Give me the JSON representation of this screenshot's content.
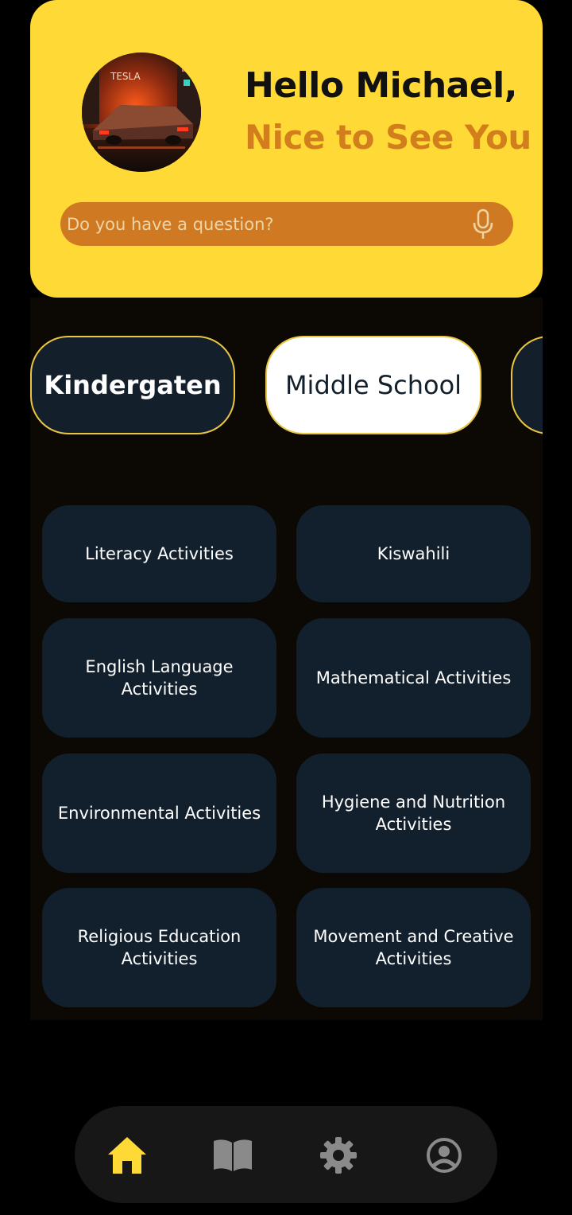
{
  "header": {
    "greeting": "Hello Michael,",
    "subgreeting": "Nice to See You",
    "search_placeholder": "Do you have a question?"
  },
  "levels": [
    {
      "label": "Kindergaten",
      "selected": false
    },
    {
      "label": "Middle School",
      "selected": true
    },
    {
      "label": "",
      "selected": false
    }
  ],
  "activities": [
    "Literacy Activities",
    "Kiswahili",
    "English Language Activities",
    "Mathematical Activities",
    "Environmental Activities",
    "Hygiene and Nutrition Activities",
    "Religious Education Activities",
    "Movement and Creative Activities"
  ],
  "nav": {
    "items": [
      "home-icon",
      "book-icon",
      "settings-icon",
      "account-icon"
    ],
    "active": "home-icon"
  },
  "colors": {
    "header_bg": "#FFD935",
    "accent_orange": "#D27E1C",
    "card_bg": "#12202D",
    "nav_active": "#FFD935",
    "nav_inactive": "#8A8A8A"
  }
}
